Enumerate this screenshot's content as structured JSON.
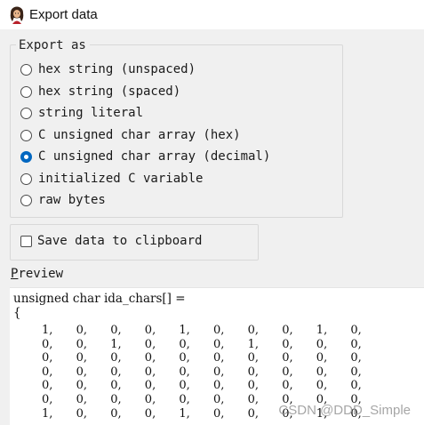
{
  "window": {
    "title": "Export data",
    "icon": "ida-app-icon"
  },
  "export_as": {
    "legend": "Export as",
    "options": [
      {
        "label": "hex string (unspaced)",
        "checked": false
      },
      {
        "label": "hex string (spaced)",
        "checked": false
      },
      {
        "label": "string literal",
        "checked": false
      },
      {
        "label": "C unsigned char array (hex)",
        "checked": false
      },
      {
        "label": "C unsigned char array (decimal)",
        "checked": true
      },
      {
        "label": "initialized C variable",
        "checked": false
      },
      {
        "label": "raw bytes",
        "checked": false
      }
    ]
  },
  "clipboard": {
    "label": "Save data to clipboard",
    "checked": false
  },
  "preview": {
    "label_underlined": "P",
    "label_rest": "review",
    "header_line": "unsigned char ida_chars[] =",
    "open_brace": "{",
    "rows": [
      [
        "1,",
        "0,",
        "0,",
        "0,",
        "1,",
        "0,",
        "0,",
        "0,",
        "1,",
        "0,"
      ],
      [
        "0,",
        "0,",
        "1,",
        "0,",
        "0,",
        "0,",
        "1,",
        "0,",
        "0,",
        "0,"
      ],
      [
        "0,",
        "0,",
        "0,",
        "0,",
        "0,",
        "0,",
        "0,",
        "0,",
        "0,",
        "0,"
      ],
      [
        "0,",
        "0,",
        "0,",
        "0,",
        "0,",
        "0,",
        "0,",
        "0,",
        "0,",
        "0,"
      ],
      [
        "0,",
        "0,",
        "0,",
        "0,",
        "0,",
        "0,",
        "0,",
        "0,",
        "0,",
        "0,"
      ],
      [
        "0,",
        "0,",
        "0,",
        "0,",
        "0,",
        "0,",
        "0,",
        "0,",
        "0,",
        "0,"
      ],
      [
        "1,",
        "0,",
        "0,",
        "0,",
        "1,",
        "0,",
        "0,",
        "0,",
        "1,",
        "0,"
      ]
    ]
  },
  "watermark": "CSDN @DDD_Simple",
  "colors": {
    "accent": "#0067c0",
    "background": "#f0f0f0",
    "preview_background": "#ffffff"
  }
}
